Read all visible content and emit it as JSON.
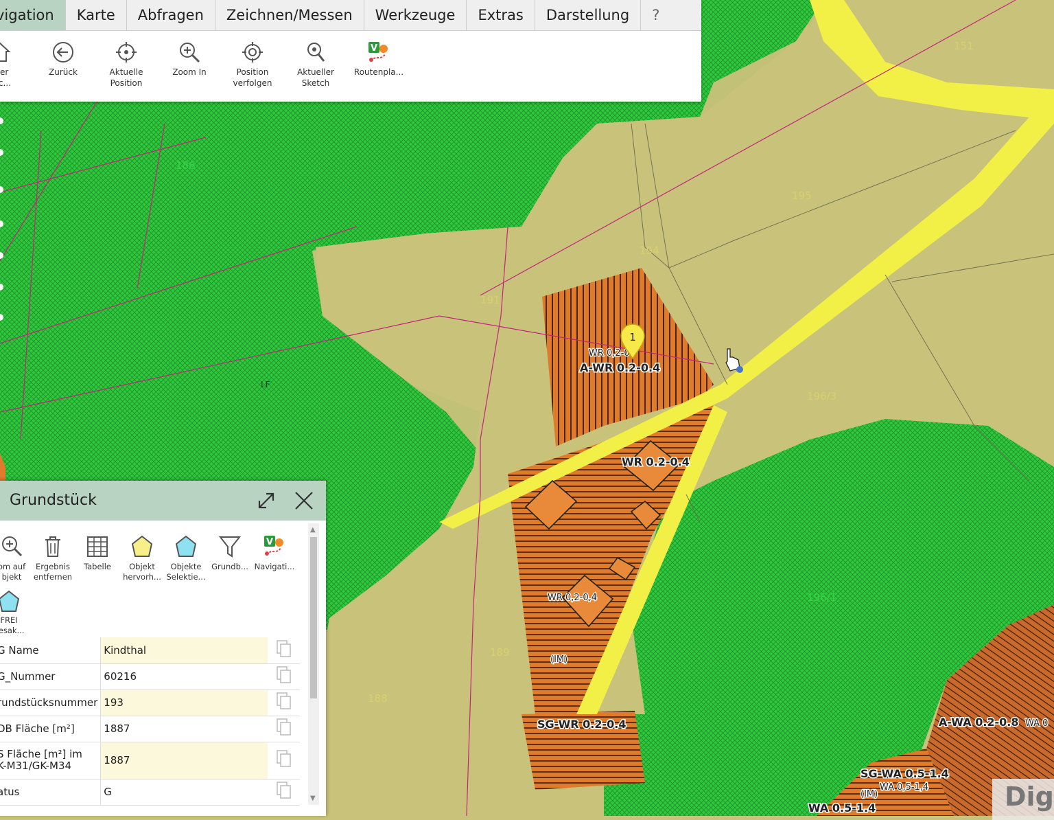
{
  "menu": {
    "tabs": [
      "vigation",
      "Karte",
      "Abfragen",
      "Zeichnen/Messen",
      "Werkzeuge",
      "Extras",
      "Darstellung",
      "?"
    ],
    "active_tab": "vigation"
  },
  "ribbon": {
    "items": [
      {
        "l1": "nter",
        "l2": "usc...",
        "icon": "home-icon"
      },
      {
        "l1": "Zurück",
        "l2": "",
        "icon": "back-arrow-icon"
      },
      {
        "l1": "Aktuelle",
        "l2": "Position",
        "icon": "crosshair-icon"
      },
      {
        "l1": "Zoom In",
        "l2": "",
        "icon": "zoom-in-icon"
      },
      {
        "l1": "Position",
        "l2": "verfolgen",
        "icon": "track-position-icon"
      },
      {
        "l1": "Aktueller",
        "l2": "Sketch",
        "icon": "map-pin-icon"
      },
      {
        "l1": "Routenpla...",
        "l2": "",
        "icon": "route-planner-icon"
      }
    ]
  },
  "map": {
    "parcels": [
      "151",
      "195",
      "194",
      "191",
      "196/3",
      "189",
      "188",
      "196/1",
      "LF",
      "186"
    ],
    "zones": {
      "wr_small": "WR 0,2-0",
      "a_wr": "A-WR 0.2-0.4",
      "wr": "WR 0.2-0.4",
      "wr_comma": "WR 0,2-0,4",
      "im": "(IM)",
      "sg_wr": "SG-WR 0.2-0.4",
      "a_wa": "A-WA 0.2-0.8",
      "wa_cut": "WA 0",
      "sg_wa": "SG-WA 0.5-1.4",
      "wa_small": "WA 0,5-1,4",
      "im2": "(IM)",
      "wa": "WA 0.5-1.4"
    },
    "marker_number": "1",
    "watermark": "Dig"
  },
  "panel": {
    "title": "Grundstück",
    "tools": [
      {
        "l1": "om auf",
        "l2": "bjekt",
        "icon": "zoom-to-object-icon"
      },
      {
        "l1": "Ergebnis",
        "l2": "entfernen",
        "icon": "trash-icon"
      },
      {
        "l1": "Tabelle",
        "l2": "",
        "icon": "table-icon"
      },
      {
        "l1": "Objekt",
        "l2": "hervorh...",
        "icon": "highlight-object-icon"
      },
      {
        "l1": "Objekte",
        "l2": "Selektie...",
        "icon": "select-objects-icon"
      },
      {
        "l1": "Grundb...",
        "l2": "",
        "icon": "filter-icon"
      },
      {
        "l1": "Navigati...",
        "l2": "",
        "icon": "navigation-icon"
      },
      {
        "l1": "FREI",
        "l2": "gesak...",
        "icon": "frei-polygon-icon"
      }
    ],
    "rows": [
      {
        "key": "G Name",
        "value": "Kindthal"
      },
      {
        "key": "G_Nummer",
        "value": "60216"
      },
      {
        "key": "rundstücksnummer",
        "value": "193"
      },
      {
        "key": "DB Fläche [m²]",
        "value": "1887"
      },
      {
        "key": "S Fläche [m²] im",
        "key2": "K-M31/GK-M34",
        "value": "1887"
      },
      {
        "key": "atus",
        "value": "G"
      }
    ]
  },
  "colors": {
    "green": "#2ec83c",
    "khaki": "#c8c27a",
    "orange": "#e07b2c",
    "yellow": "#f2f046",
    "accent": "#b9d3c3"
  }
}
